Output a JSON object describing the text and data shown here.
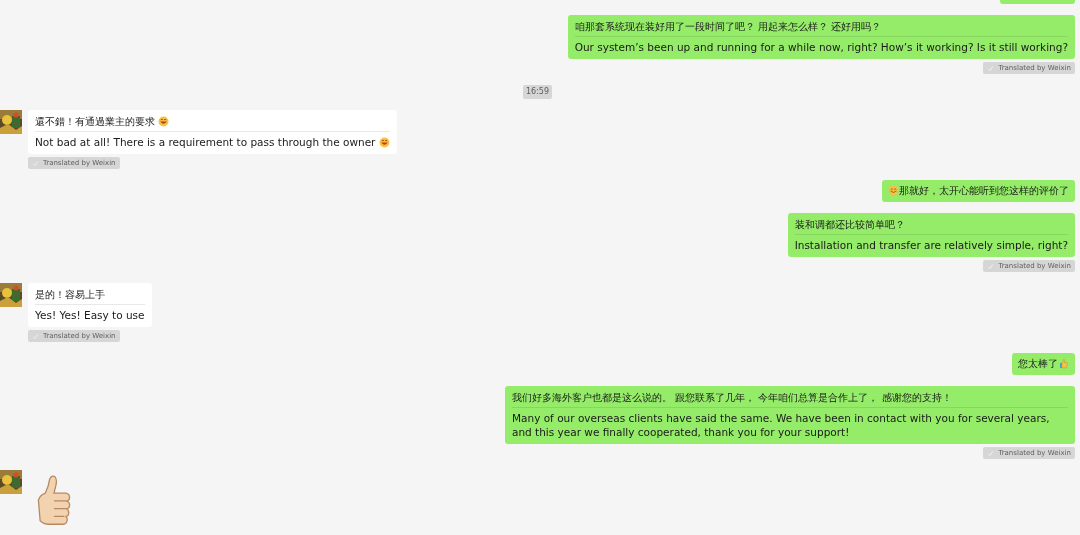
{
  "messages": [
    {
      "outgoing": true,
      "kind": "clipped"
    },
    {
      "outgoing": true,
      "kind": "translated",
      "original": "咱那套系统现在装好用了一段时间了吧？ 用起来怎么样？ 还好用吗？",
      "translation": "Our system’s been up and running for a while now, right? How’s it working? Is it still working?",
      "tag": "Translated by Weixin"
    },
    {
      "kind": "time",
      "text": "16:59"
    },
    {
      "outgoing": false,
      "kind": "translated",
      "original": "還不錯！有通過業主的要求",
      "original_emoji_after": {
        "kind": "grin"
      },
      "translation": "Not bad at all! There is a requirement to pass through the owner",
      "translation_emoji_after": {
        "kind": "grin"
      },
      "tag": "Translated by Weixin"
    },
    {
      "outgoing": true,
      "kind": "text",
      "text": "那就好，太开心能听到您这样的评价了",
      "emoji_before": {
        "kind": "smile"
      }
    },
    {
      "outgoing": true,
      "kind": "translated",
      "original": "装和调都还比较简单吧？",
      "translation": "Installation and transfer are relatively simple, right?",
      "tag": "Translated by Weixin"
    },
    {
      "outgoing": false,
      "kind": "translated",
      "original": "是的！容易上手",
      "translation": "Yes! Yes! Easy to use",
      "tag": "Translated by Weixin"
    },
    {
      "outgoing": true,
      "kind": "text",
      "text": "您太棒了",
      "emoji_after": {
        "kind": "thumb"
      }
    },
    {
      "outgoing": true,
      "kind": "translated",
      "original": "我们好多海外客户也都是这么说的。 跟您联系了几年， 今年咱们总算是合作上了， 感谢您的支持！",
      "translation": "Many of our overseas clients have said the same. We have been in contact with you for several years, and this year we finally cooperated, thank you for your support!",
      "tag": "Translated by Weixin"
    },
    {
      "outgoing": false,
      "kind": "sticker"
    }
  ]
}
